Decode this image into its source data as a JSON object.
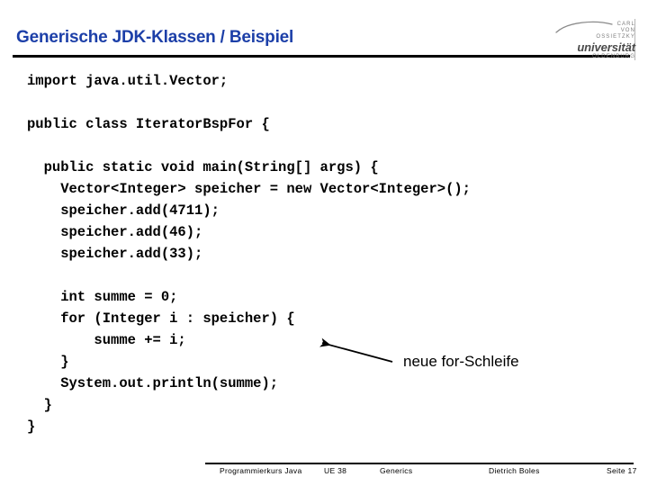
{
  "header": {
    "title": "Generische JDK-Klassen / Beispiel",
    "title_color": "#1c3fa8"
  },
  "logo": {
    "line1": "CARL",
    "line2": "VON",
    "line3": "OSSIETZKY",
    "wordmark": "universität",
    "city": "OLDENBURG"
  },
  "code": {
    "lines": [
      "import java.util.Vector;",
      "",
      "public class IteratorBspFor {",
      "",
      "  public static void main(String[] args) {",
      "    Vector<Integer> speicher = new Vector<Integer>();",
      "    speicher.add(4711);",
      "    speicher.add(46);",
      "    speicher.add(33);",
      "",
      "    int summe = 0;",
      "    for (Integer i : speicher) {",
      "        summe += i;",
      "    }",
      "    System.out.println(summe);",
      "  }",
      "}"
    ]
  },
  "annotation": {
    "label": "neue for-Schleife"
  },
  "footer": {
    "course": "Programmierkurs Java",
    "unit": "UE 38",
    "topic": "Generics",
    "author": "Dietrich Boles",
    "page": "Seite 17"
  }
}
